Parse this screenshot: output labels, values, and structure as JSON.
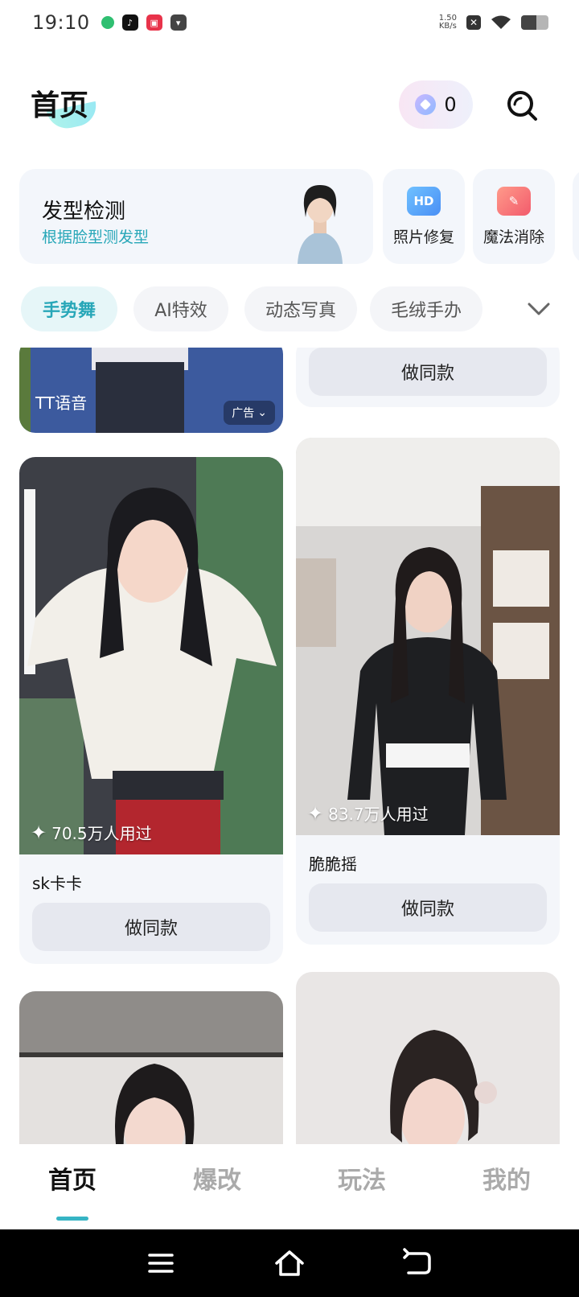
{
  "status_bar": {
    "time": "19:10",
    "net_speed_value": "1.50",
    "net_speed_unit": "KB/s",
    "battery_level": 0.55
  },
  "header": {
    "title": "首页",
    "coin_count": "0"
  },
  "features": {
    "main": {
      "title": "发型检测",
      "subtitle": "根据脸型测发型"
    },
    "items": [
      {
        "label": "照片修复",
        "icon": "hd-icon",
        "badge": "HD"
      },
      {
        "label": "魔法消除",
        "icon": "eraser-icon"
      }
    ]
  },
  "categories": [
    "手势舞",
    "AI特效",
    "动态写真",
    "毛绒手办"
  ],
  "feed": {
    "ad": {
      "label": "TT语音",
      "tag": "广告"
    },
    "partial_card_button": "做同款",
    "cards": [
      {
        "title": "sk卡卡",
        "users": "70.5万人用过",
        "button": "做同款"
      },
      {
        "title": "脆脆摇",
        "users": "83.7万人用过",
        "button": "做同款"
      }
    ]
  },
  "bottom_nav": [
    "首页",
    "爆改",
    "玩法",
    "我的"
  ],
  "colors": {
    "accent": "#28a7b8",
    "card_bg": "#f4f6fa",
    "button_bg": "#e6e8ef"
  }
}
